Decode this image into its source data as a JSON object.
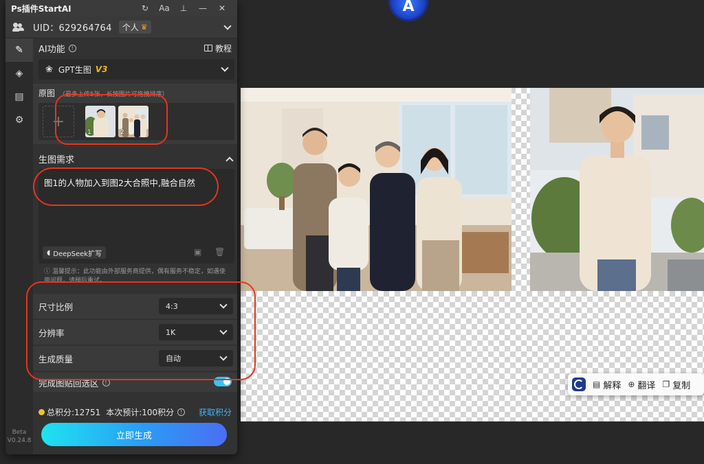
{
  "panel": {
    "title": "Ps插件StartAI",
    "titlebar_buttons": [
      "refresh-icon",
      "font-size-icon",
      "pin-icon",
      "minimize-icon",
      "close-icon"
    ],
    "font_btn_label": "Aa",
    "uid_text": "UID：629264764",
    "plan_badge": "个人"
  },
  "sidebar": {
    "items": [
      "pencil-icon",
      "layers-icon",
      "document-icon",
      "gear-icon"
    ],
    "version_line1": "Beta",
    "version_line2": "V0.24.8"
  },
  "ai_function": {
    "label": "AI功能",
    "tutorial": "教程",
    "selected_model": "GPT生图",
    "model_version": "V3"
  },
  "source_images": {
    "label": "原图",
    "hint": "（最多上传5张，长按图片可拖拽排序）",
    "thumbnails": [
      {
        "index": "1"
      },
      {
        "index": "2"
      }
    ]
  },
  "requirements": {
    "label": "生图需求",
    "prompt_text": "图1的人物加入到图2大合照中,融合自然",
    "deepseek_button": "DeepSeek扩写",
    "tip": "温馨提示：此功能由外部服务商提供，偶有服务不稳定，如遇使用问题，请稍后重试。"
  },
  "options": [
    {
      "label": "尺寸比例",
      "value": "4:3"
    },
    {
      "label": "分辨率",
      "value": "1K"
    },
    {
      "label": "生成质量",
      "value": "自动"
    }
  ],
  "paste_toggle": {
    "label": "完成图贴回选区",
    "enabled": true
  },
  "points": {
    "total": "总积分:12751",
    "estimate": "本次预计:100积分",
    "get_link": "获取积分"
  },
  "generate_button": "立即生成",
  "floating_toolbar": {
    "explain": "解释",
    "translate": "翻译",
    "copy": "复制"
  },
  "colors": {
    "accent": "#38c3f2",
    "annotation": "#e8341c",
    "version_badge": "#f2b327"
  }
}
